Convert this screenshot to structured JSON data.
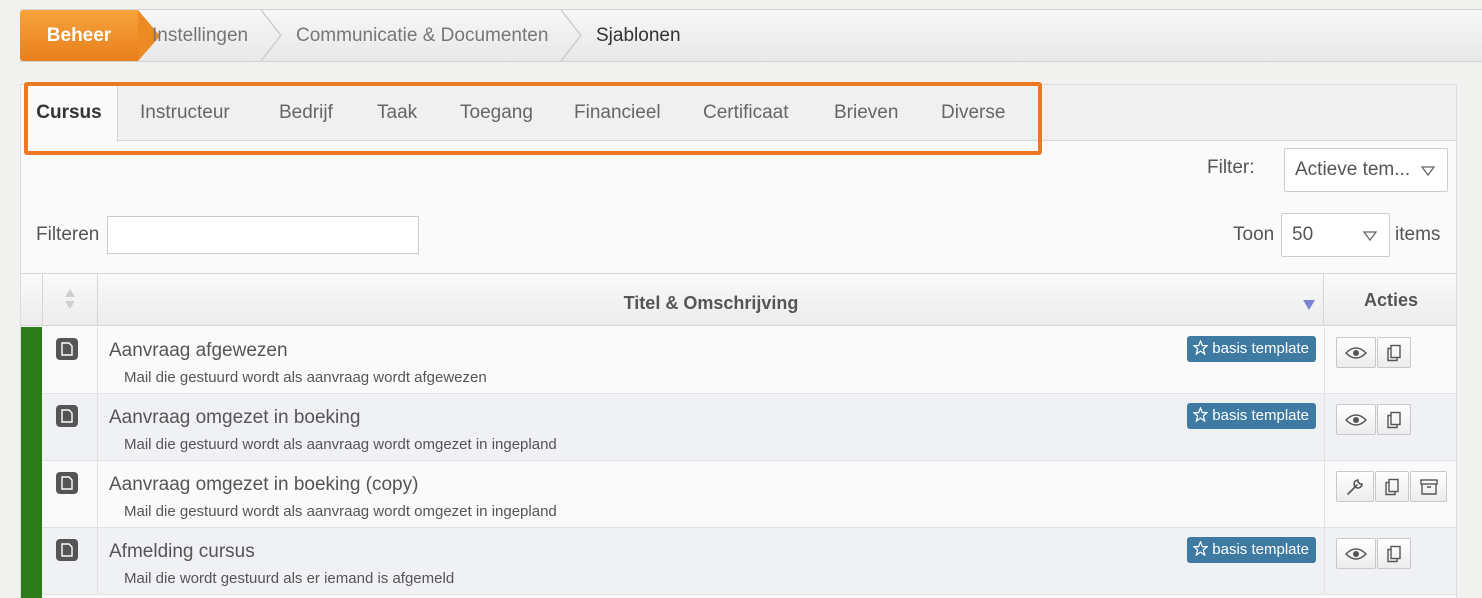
{
  "breadcrumb": {
    "items": [
      "Beheer",
      "Instellingen",
      "Communicatie & Documenten",
      "Sjablonen"
    ]
  },
  "tabs": [
    "Cursus",
    "Instructeur",
    "Bedrijf",
    "Taak",
    "Toegang",
    "Financieel",
    "Certificaat",
    "Brieven",
    "Diverse"
  ],
  "active_tab": "Cursus",
  "filter": {
    "label": "Filter:",
    "value": "Actieve tem..."
  },
  "search": {
    "label": "Filteren",
    "value": ""
  },
  "paging": {
    "show_label": "Toon",
    "page_size": "50",
    "items_label": "items"
  },
  "table": {
    "columns": [
      "Titel & Omschrijving",
      "Acties"
    ],
    "rows": [
      {
        "title": "Aanvraag afgewezen",
        "description": "Mail die gestuurd wordt als aanvraag wordt afgewezen",
        "badge": "basis template"
      },
      {
        "title": "Aanvraag omgezet in boeking",
        "description": "Mail die gestuurd wordt als aanvraag wordt omgezet in ingepland",
        "badge": "basis template"
      },
      {
        "title": "Aanvraag omgezet in boeking (copy)",
        "description": "Mail die gestuurd wordt als aanvraag wordt omgezet in ingepland",
        "badge": ""
      },
      {
        "title": "Afmelding cursus",
        "description": "Mail die wordt gestuurd als er iemand is afgemeld",
        "badge": "basis template"
      }
    ]
  },
  "icons": {
    "sort": "sort-icon",
    "sort_desc": "sort-desc-icon",
    "document": "document-icon",
    "star": "star-icon",
    "view": "eye-icon",
    "copy": "copy-icon",
    "edit": "wrench-icon",
    "archive": "archive-icon",
    "caret": "chevron-down-icon"
  },
  "colors": {
    "accent_orange": "#ed7823",
    "badge_blue": "#3f7aa3",
    "status_green": "#2d7a1a"
  }
}
